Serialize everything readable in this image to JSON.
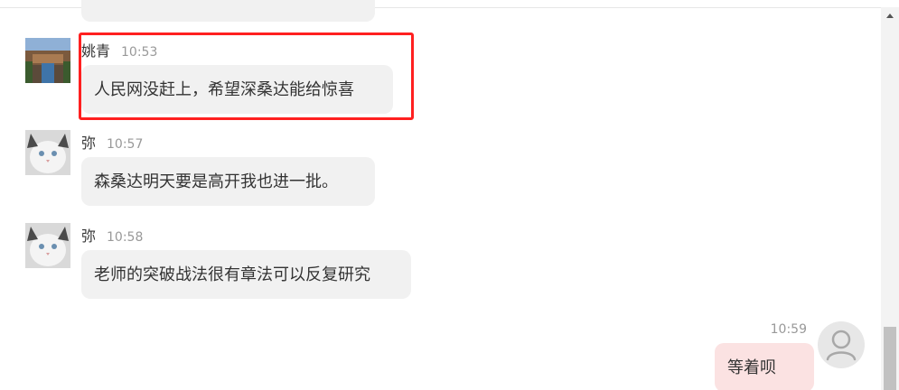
{
  "colors": {
    "incoming_bubble": "#f1f1f1",
    "outgoing_bubble": "#fbe2e2",
    "highlight_border": "#ff2020",
    "timestamp": "#999999"
  },
  "messages": [
    {
      "sender": "姚青",
      "time": "10:53",
      "text": "人民网没赶上，希望深桑达能给惊喜",
      "avatar_icon": "palace-photo-avatar"
    },
    {
      "sender": "弥",
      "time": "10:57",
      "text": "森桑达明天要是高开我也进一批。",
      "avatar_icon": "cat-photo-avatar"
    },
    {
      "sender": "弥",
      "time": "10:58",
      "text": "老师的突破战法很有章法可以反复研究",
      "avatar_icon": "cat-photo-avatar"
    }
  ],
  "self_message": {
    "time": "10:59",
    "text": "等着呗",
    "avatar_icon": "default-user-avatar-icon"
  }
}
